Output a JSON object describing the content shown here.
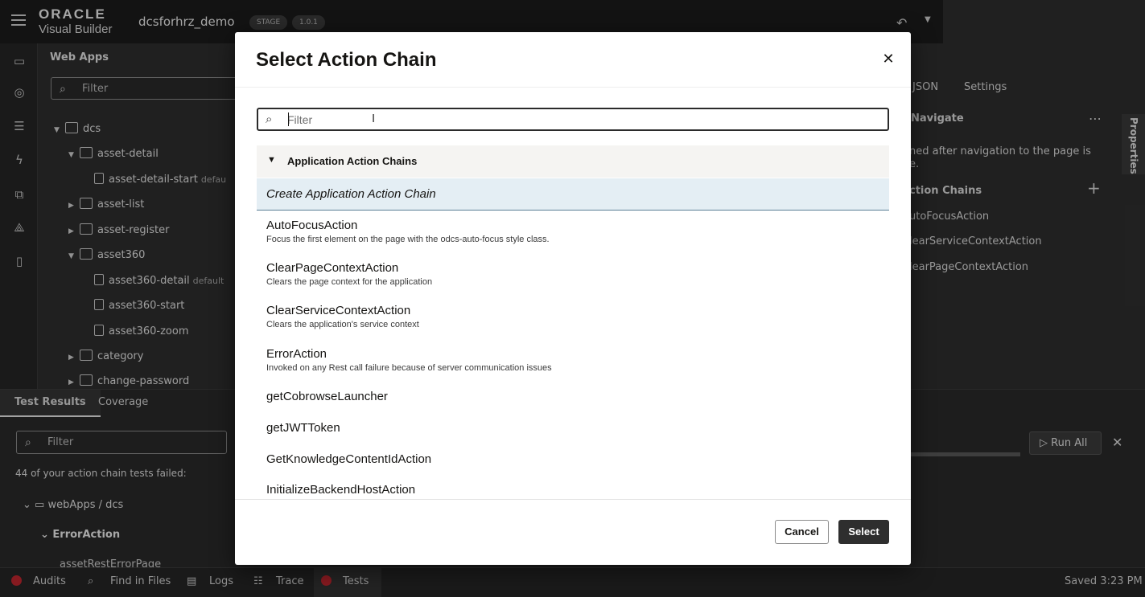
{
  "header": {
    "logo_line1": "ORACLE",
    "logo_line2": "Visual Builder",
    "app_name": "dcsforhrz_demo",
    "stage_badge": "STAGE",
    "version_badge": "1.0.1"
  },
  "web_apps": {
    "title": "Web Apps",
    "filter_placeholder": "Filter",
    "tree": [
      {
        "label": "dcs",
        "toggle": "▼",
        "default_tag": ""
      },
      {
        "label": "asset-detail",
        "toggle": "▼",
        "default_tag": ""
      },
      {
        "label": "asset-detail-start",
        "toggle": "",
        "default_tag": "defau"
      },
      {
        "label": "asset-list",
        "toggle": "▶",
        "default_tag": ""
      },
      {
        "label": "asset-register",
        "toggle": "▶",
        "default_tag": ""
      },
      {
        "label": "asset360",
        "toggle": "▼",
        "default_tag": ""
      },
      {
        "label": "asset360-detail",
        "toggle": "",
        "default_tag": "default"
      },
      {
        "label": "asset360-start",
        "toggle": "",
        "default_tag": ""
      },
      {
        "label": "asset360-zoom",
        "toggle": "",
        "default_tag": ""
      },
      {
        "label": "category",
        "toggle": "▶",
        "default_tag": ""
      },
      {
        "label": "change-password",
        "toggle": "▶",
        "default_tag": ""
      }
    ]
  },
  "right_panel": {
    "tab_json": "JSON",
    "tab_settings": "Settings",
    "event_title": "Navigate",
    "desc_line1": "ned after navigation to the page is",
    "desc_line2": "e.",
    "chains_title": "ction Chains",
    "chains": [
      "utoFocusAction",
      "learServiceContextAction",
      "learPageContextAction"
    ],
    "vertical_tab": "Properties"
  },
  "bottom": {
    "tab_results": "Test Results",
    "tab_coverage": "Coverage",
    "filter_placeholder": "Filter",
    "failed_text": "44 of your action chain tests failed:",
    "crumb": "webApps / dcs",
    "error_group": "ErrorAction",
    "cut_item": "assetRestErrorPage",
    "run_all": "Run All"
  },
  "statusbar": {
    "audits": "Audits",
    "find": "Find in Files",
    "logs": "Logs",
    "trace": "Trace",
    "tests": "Tests",
    "saved": "Saved 3:23 PM"
  },
  "modal": {
    "title": "Select Action Chain",
    "filter_placeholder": "Filter",
    "group_label": "Application Action Chains",
    "create_label": "Create Application Action Chain",
    "items": [
      {
        "name": "AutoFocusAction",
        "desc": "Focus the first element on the page with the odcs-auto-focus style class."
      },
      {
        "name": "ClearPageContextAction",
        "desc": "Clears the page context for the application"
      },
      {
        "name": "ClearServiceContextAction",
        "desc": "Clears the application's service context"
      },
      {
        "name": "ErrorAction",
        "desc": "Invoked on any Rest call failure because of server communication issues"
      },
      {
        "name": "getCobrowseLauncher",
        "desc": ""
      },
      {
        "name": "getJWTToken",
        "desc": ""
      },
      {
        "name": "GetKnowledgeContentIdAction",
        "desc": ""
      },
      {
        "name": "InitializeBackendHostAction",
        "desc": ""
      }
    ],
    "cancel_label": "Cancel",
    "select_label": "Select"
  },
  "colors": {
    "highlight_row": "#e4eef4",
    "primary_button": "#2e2e2e",
    "error_dot": "#c0262f"
  }
}
